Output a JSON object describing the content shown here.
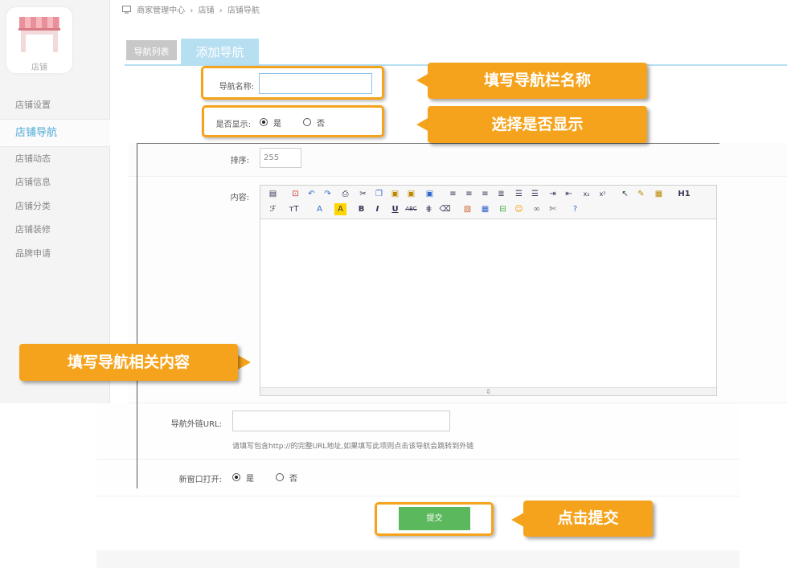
{
  "sidebar": {
    "logo_label": "店铺",
    "items": [
      {
        "label": "店铺设置",
        "active": false
      },
      {
        "label": "店铺导航",
        "active": true
      },
      {
        "label": "店铺动态",
        "active": false
      },
      {
        "label": "店铺信息",
        "active": false
      },
      {
        "label": "店铺分类",
        "active": false
      },
      {
        "label": "店铺装修",
        "active": false
      },
      {
        "label": "品牌申请",
        "active": false
      }
    ]
  },
  "breadcrumb": [
    "商家管理中心",
    "店铺",
    "店铺导航"
  ],
  "tabs": {
    "list": "导航列表",
    "add": "添加导航"
  },
  "form": {
    "name_label": "导航名称:",
    "name_value": "",
    "show_label": "是否显示:",
    "show_yes": "是",
    "show_no": "否",
    "sort_label": "排序:",
    "sort_value": "255",
    "content_label": "内容:",
    "url_label": "导航外链URL:",
    "url_value": "",
    "url_hint": "请填写包含http://的完整URL地址,如果填写此项则点击该导航会跳转到外链",
    "newwin_label": "新窗口打开:",
    "newwin_yes": "是",
    "newwin_no": "否",
    "submit": "提交"
  },
  "editor": {
    "heading_button": "H1",
    "toolbar_icons": [
      "source-icon",
      "preview-icon",
      "undo-icon",
      "redo-icon",
      "print-icon",
      "cut-icon",
      "copy-icon",
      "paste-icon",
      "paste-text-icon",
      "paste-word-icon",
      "align-left-icon",
      "align-center-icon",
      "align-right-icon",
      "justify-icon",
      "ordered-list-icon",
      "unordered-list-icon",
      "indent-icon",
      "outdent-icon",
      "subscript-icon",
      "superscript-icon",
      "select-all-icon",
      "clear-format-icon",
      "quick-format-icon",
      "heading-icon",
      "font-family-icon",
      "font-size-icon",
      "font-color-icon",
      "highlight-icon",
      "bold-icon",
      "italic-icon",
      "underline-icon",
      "strikethrough-icon",
      "line-height-icon",
      "remove-format-icon",
      "image-icon",
      "table-icon",
      "hr-icon",
      "emoticon-icon",
      "link-icon",
      "unlink-icon",
      "about-icon"
    ]
  },
  "callouts": {
    "name": "填写导航栏名称",
    "show": "选择是否显示",
    "content": "填写导航相关内容",
    "submit": "点击提交"
  },
  "colors": {
    "callout": "#f5a31c",
    "tab_active": "#b7dff2",
    "sidebar_active": "#4ea9d9",
    "submit": "#5cb85c"
  }
}
